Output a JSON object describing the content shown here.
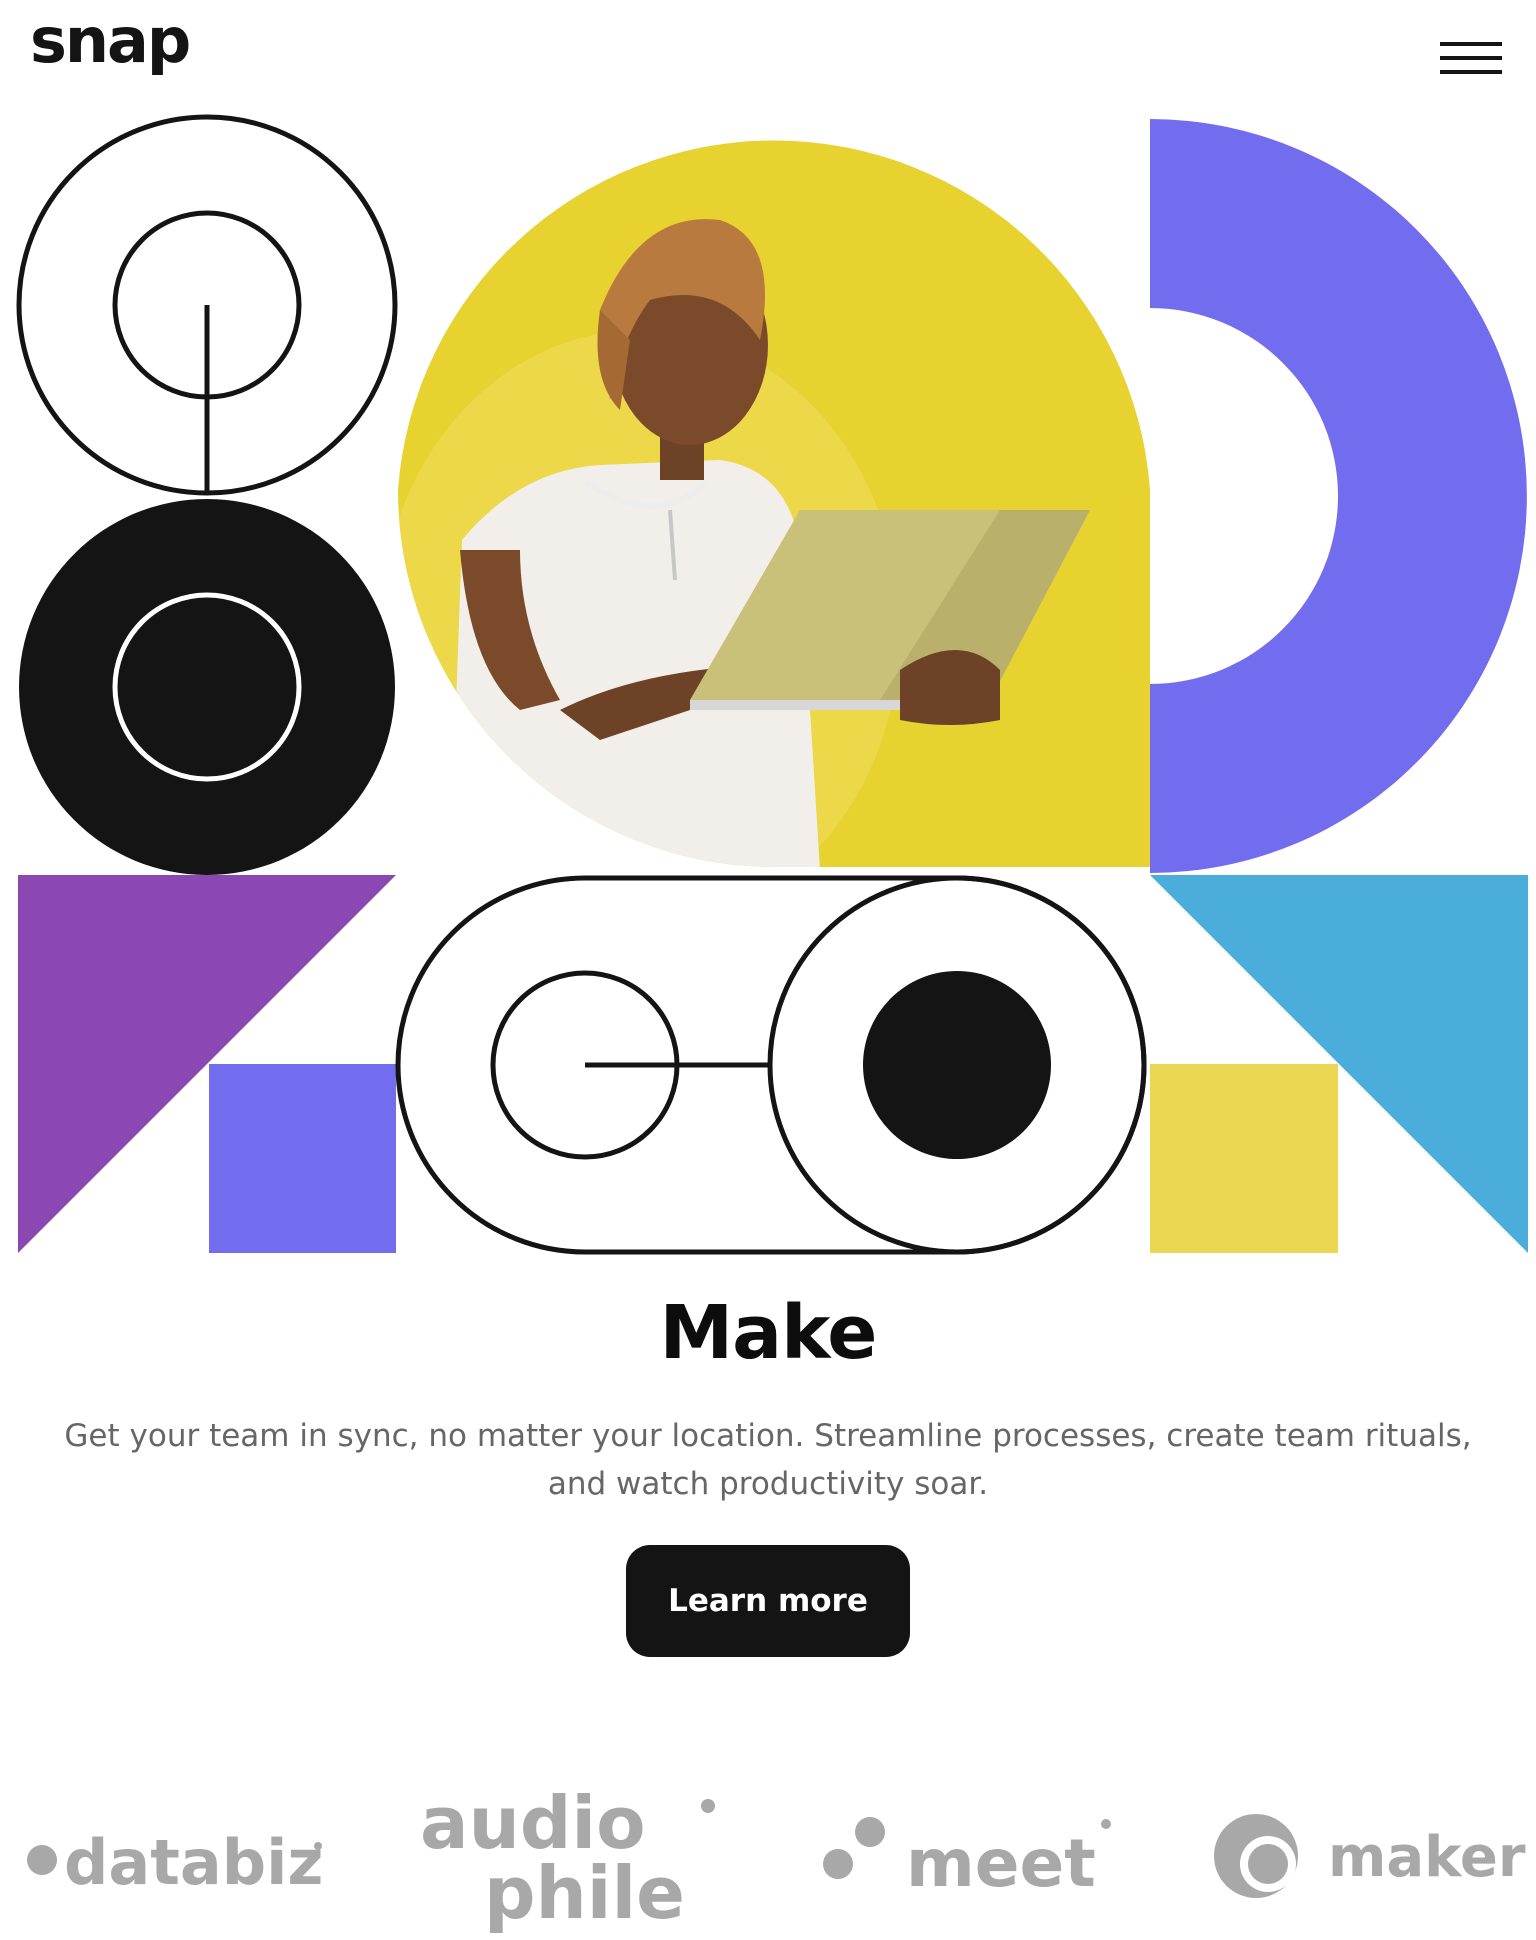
{
  "header": {
    "logo": "snap",
    "menu_icon": "hamburger-menu-icon"
  },
  "hero": {
    "illustration_colors": {
      "yellow": "#E8D22F",
      "periwinkle": "#716DEE",
      "purple": "#8B48B3",
      "sky_blue": "#4BAEDA",
      "pale_yellow": "#EBD651",
      "black": "#141414"
    },
    "title": "Make",
    "description": "Get your team in sync, no matter your location. Streamline processes, create team rituals, and watch productivity soar.",
    "cta_label": "Learn more"
  },
  "partners": {
    "color": "#A8A8A8",
    "items": [
      {
        "name": "databiz",
        "icon": "databiz-logo"
      },
      {
        "name_line1": "audio",
        "name_line2": "phile",
        "icon": "audiophile-logo"
      },
      {
        "name": "meet",
        "icon": "meet-logo"
      },
      {
        "name": "maker",
        "icon": "maker-logo"
      }
    ]
  }
}
